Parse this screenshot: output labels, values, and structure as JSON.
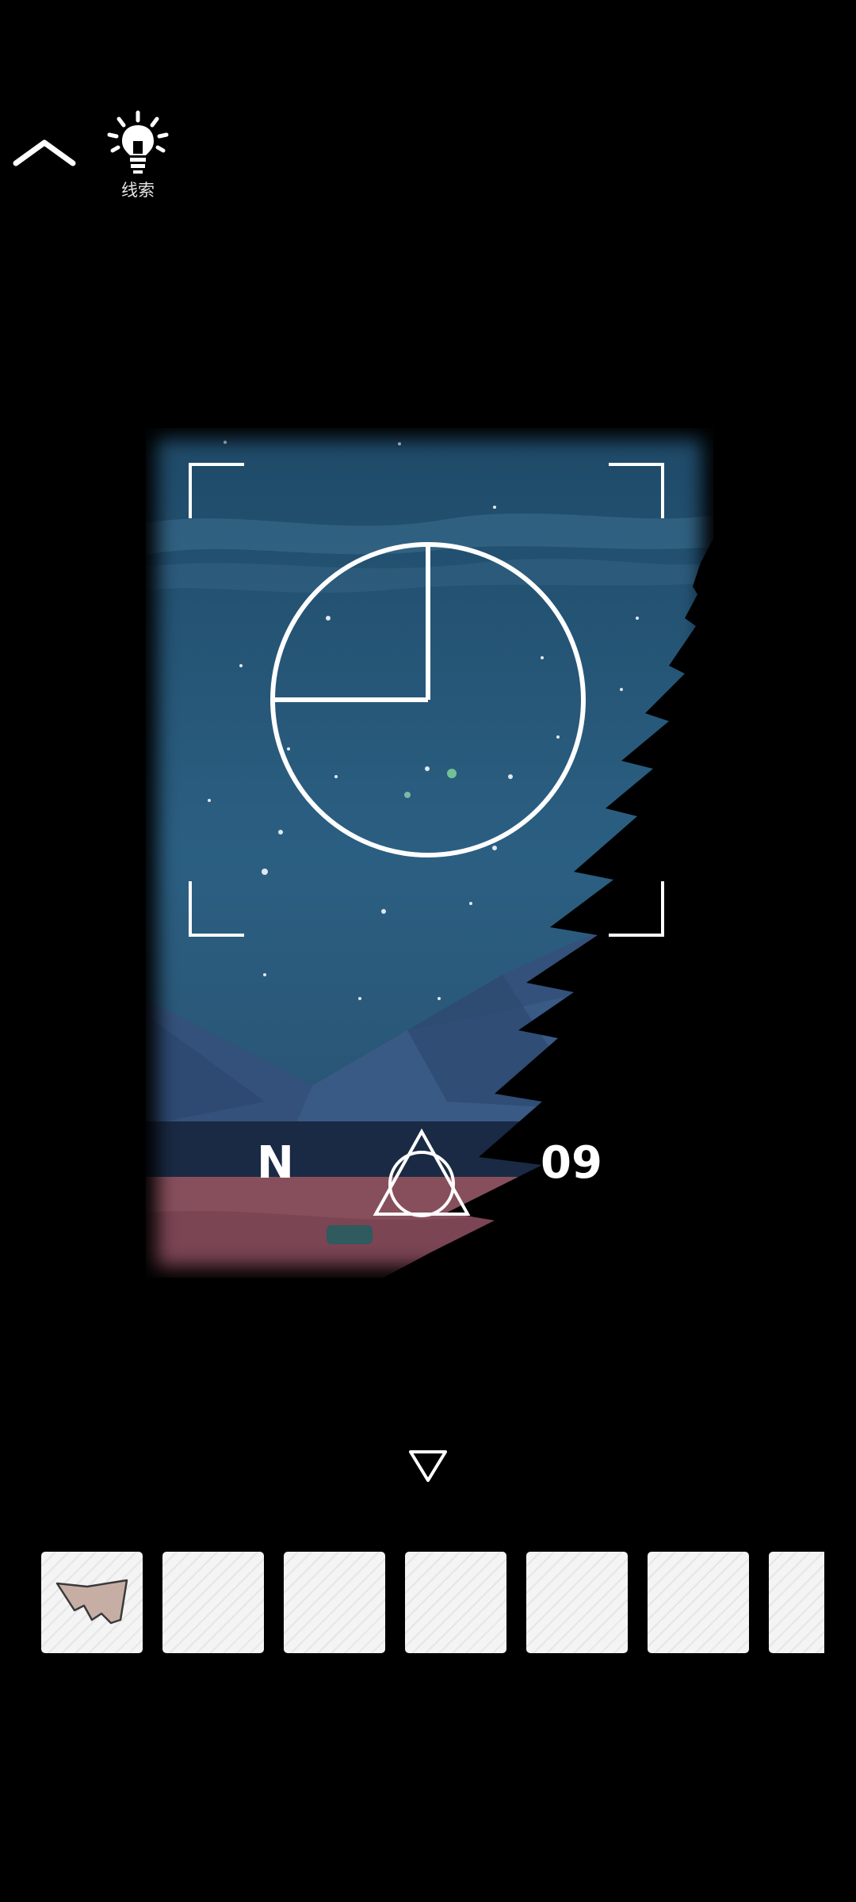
{
  "top_bar": {
    "back_icon": "chevron-up-icon",
    "hint_icon": "lightbulb-icon",
    "hint_label": "线索"
  },
  "scene": {
    "compass_letter": "N",
    "compass_number": "09",
    "symbol": "triangle-circle-symbol",
    "clock_face": "quarter-circle-dial"
  },
  "navigation": {
    "down_icon": "triangle-down-icon"
  },
  "inventory": {
    "slots": [
      {
        "item": "paper-scrap",
        "filled": true
      },
      {
        "item": "",
        "filled": false
      },
      {
        "item": "",
        "filled": false
      },
      {
        "item": "",
        "filled": false
      },
      {
        "item": "",
        "filled": false
      },
      {
        "item": "",
        "filled": false
      },
      {
        "item": "",
        "filled": false
      }
    ]
  },
  "colors": {
    "background": "#000000",
    "sky": "#2a5c7e",
    "overlay_lines": "#ffffff",
    "slot_fill": "#f4f4f4",
    "item_fill": "#c7aea5"
  }
}
